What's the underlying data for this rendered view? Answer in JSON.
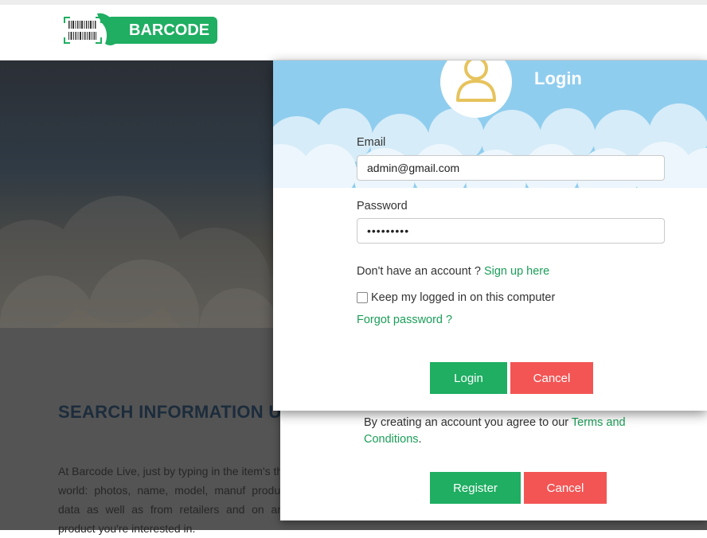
{
  "header": {
    "logo_text": "BARCODE"
  },
  "background_page": {
    "section_title": "SEARCH INFORMATION U",
    "paragraph": "At Barcode Live, just by typing in the item's the world: photos, name, model, manuf product data as well as from retailers and on any product you're interested in."
  },
  "login_modal": {
    "title": "Login",
    "email_label": "Email",
    "email_value": "admin@gmail.com",
    "password_label": "Password",
    "password_value": "•••••••••",
    "no_account_text": "Don't have an account ? ",
    "signup_link": "Sign up here",
    "remember_label": "Keep my logged in on this computer",
    "forgot_link": "Forgot password ?",
    "login_button": "Login",
    "cancel_button": "Cancel"
  },
  "register_modal": {
    "agree_text": "By creating an account you agree to our ",
    "terms_link": "Terms and Conditions",
    "period": ".",
    "register_button": "Register",
    "cancel_button": "Cancel"
  },
  "colors": {
    "brand_green": "#1fae62",
    "cancel_red": "#f35555",
    "sky_blue": "#8fcdee",
    "avatar_yellow": "#e6c35c"
  }
}
